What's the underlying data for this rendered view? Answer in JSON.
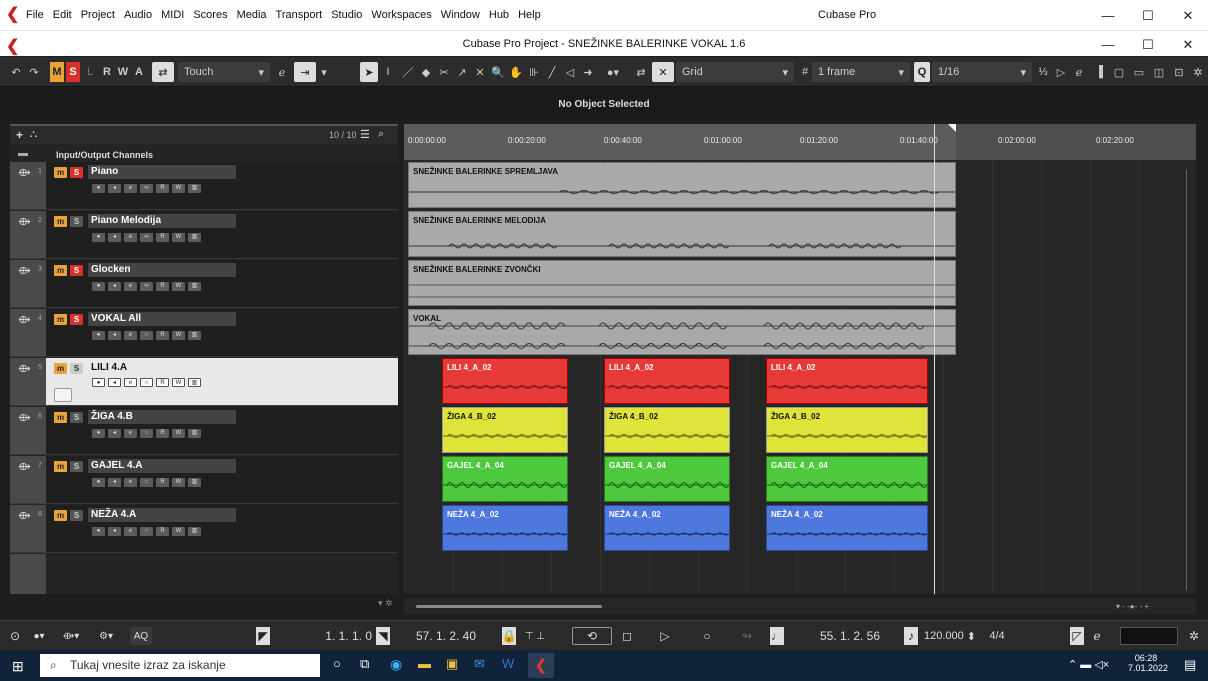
{
  "menubar": {
    "items": [
      "File",
      "Edit",
      "Project",
      "Audio",
      "MIDI",
      "Scores",
      "Media",
      "Transport",
      "Studio",
      "Workspaces",
      "Window",
      "Hub",
      "Help"
    ],
    "app_title": "Cubase Pro",
    "min": "—",
    "max": "☐",
    "close": "✕"
  },
  "titlebar": {
    "title": "Cubase Pro Project - SNEŽINKE BALERINKE VOKAL 1.6"
  },
  "toolbar": {
    "m": "M",
    "s": "S",
    "l": "L",
    "r": "R",
    "w": "W",
    "a": "A",
    "automation_mode": "Touch",
    "snap_type": "Grid",
    "quantize_frame": "1 frame",
    "q_label": "Q",
    "quantize": "1/16"
  },
  "infoline": {
    "text": "No Object Selected"
  },
  "tracklist": {
    "count": "10 / 10",
    "io_channels": "Input/Output Channels",
    "tracks": [
      {
        "num": "1",
        "name": "Piano"
      },
      {
        "num": "2",
        "name": "Piano Melodija"
      },
      {
        "num": "3",
        "name": "Glocken"
      },
      {
        "num": "4",
        "name": "VOKAL All"
      },
      {
        "num": "5",
        "name": "LILI 4.A"
      },
      {
        "num": "6",
        "name": "ŽIGA 4.B"
      },
      {
        "num": "7",
        "name": "GAJEL 4.A"
      },
      {
        "num": "8",
        "name": "NEŽA 4.A"
      }
    ],
    "m_label": "m",
    "s_label": "S"
  },
  "ruler": {
    "labels": [
      "0:00:00:00",
      "0:00:20:00",
      "0:00:40:00",
      "0:01:00:00",
      "0:01:20:00",
      "0:01:40:00",
      "0:02:00:00",
      "0:02:20:00"
    ]
  },
  "events": {
    "piano": "SNEŽINKE BALERINKE SPREMLJAVA",
    "melodija": "SNEŽINKE BALERINKE MELODIJA",
    "zvoncki": "SNEŽINKE BALERINKE ZVONČKI",
    "vokal": "VOKAL",
    "lili": "LILI 4_A_02",
    "ziga": "ŽIGA 4_B_02",
    "gajel": "GAJEL 4_A_04",
    "neza": "NEŽA 4_A_02"
  },
  "colors": {
    "lili": "#e53a36",
    "ziga": "#dfe43a",
    "gajel": "#4ec83d",
    "neza": "#4f78df",
    "grey_event": "#a9a9a9"
  },
  "transport": {
    "left_locator": "1. 1. 1.  0",
    "right_locator": "57. 1. 2. 40",
    "position": "55. 1. 2. 56",
    "tempo": "120.000",
    "signature": "4/4",
    "aq": "AQ"
  },
  "taskbar": {
    "search_placeholder": "Tukaj vnesite izraz za iskanje",
    "time": "06:28",
    "date": "7.01.2022"
  }
}
